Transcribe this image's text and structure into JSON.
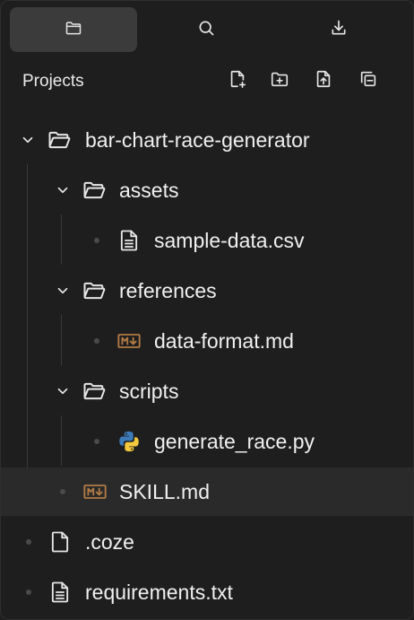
{
  "tabs": [
    {
      "name": "files",
      "icon": "folder-icon",
      "active": true
    },
    {
      "name": "search",
      "icon": "search-icon",
      "active": false
    },
    {
      "name": "download",
      "icon": "download-icon",
      "active": false
    }
  ],
  "header": {
    "title": "Projects",
    "actions": [
      "new-file-icon",
      "new-folder-icon",
      "upload-icon",
      "collapse-all-icon"
    ]
  },
  "tree": [
    {
      "label": "bar-chart-race-generator",
      "type": "folder",
      "expanded": true
    },
    {
      "label": "assets",
      "type": "folder",
      "expanded": true
    },
    {
      "label": "sample-data.csv",
      "type": "file-text"
    },
    {
      "label": "references",
      "type": "folder",
      "expanded": true
    },
    {
      "label": "data-format.md",
      "type": "file-markdown"
    },
    {
      "label": "scripts",
      "type": "folder",
      "expanded": true
    },
    {
      "label": "generate_race.py",
      "type": "file-python"
    },
    {
      "label": "SKILL.md",
      "type": "file-markdown",
      "selected": true
    },
    {
      "label": ".coze",
      "type": "file-blank"
    },
    {
      "label": "requirements.txt",
      "type": "file-text"
    }
  ],
  "colors": {
    "background": "#1e1e1e",
    "active_tab": "#3b3b3b",
    "selected_row": "#2a2a2a",
    "text": "#f0f0f0",
    "markdown_icon": "#b07a45",
    "python_blue": "#3d7ab8",
    "python_yellow": "#f5c93d"
  }
}
